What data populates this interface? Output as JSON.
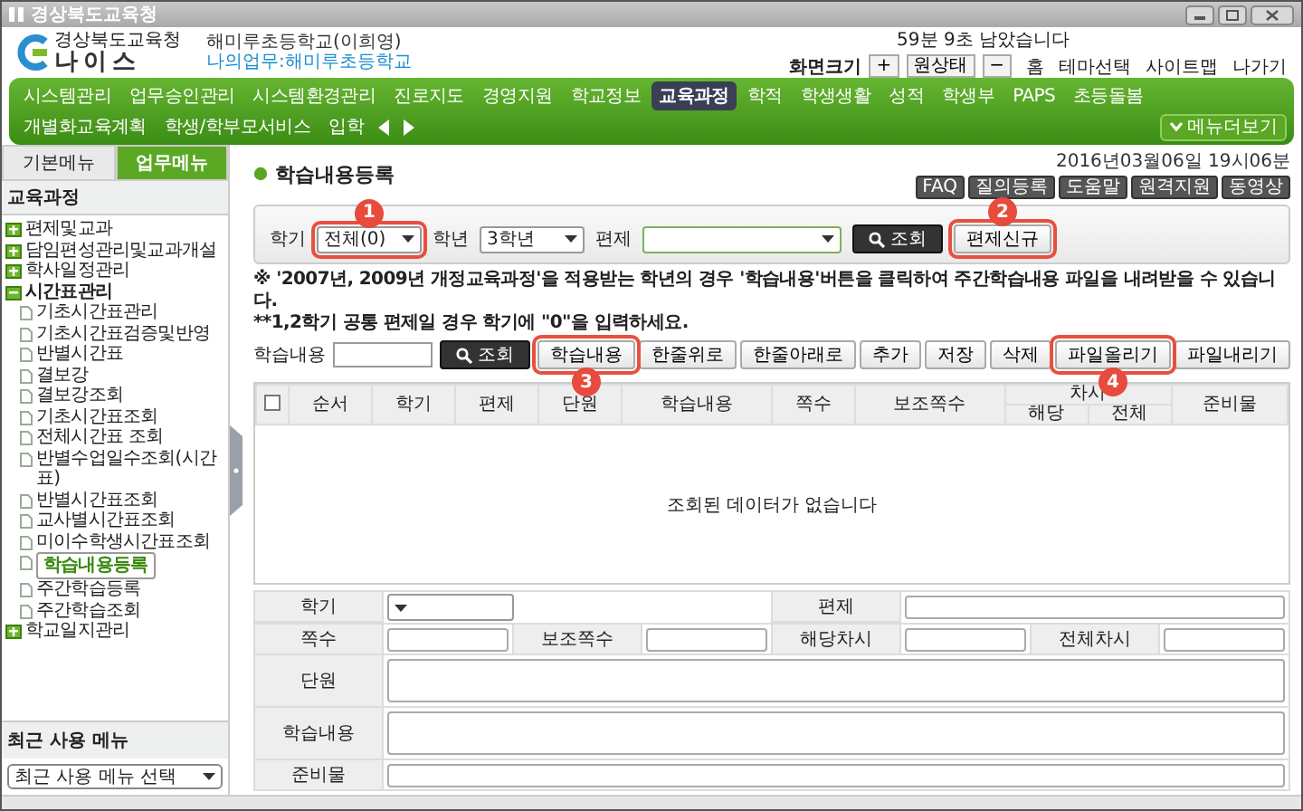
{
  "window": {
    "title": "경상북도교육청"
  },
  "header": {
    "logo_caption": "경상북도교육청",
    "logo_name": "나이스",
    "school": "해미루초등학교(이희영)",
    "my_work": "나의업무:해미루초등학교",
    "session": "59분 9초 남았습니다",
    "zoom_label": "화면크기",
    "zoom_buttons": [
      "+",
      "원상태",
      "−"
    ],
    "links": [
      "홈",
      "테마선택",
      "사이트맵",
      "나가기"
    ]
  },
  "menu": {
    "items": [
      {
        "label": "시스템관리",
        "selected": false
      },
      {
        "label": "업무승인관리",
        "selected": false
      },
      {
        "label": "시스템환경관리",
        "selected": false
      },
      {
        "label": "진로지도",
        "selected": false
      },
      {
        "label": "경영지원",
        "selected": false
      },
      {
        "label": "학교정보",
        "selected": false
      },
      {
        "label": "교육과정",
        "selected": true
      },
      {
        "label": "학적",
        "selected": false
      },
      {
        "label": "학생생활",
        "selected": false
      },
      {
        "label": "성적",
        "selected": false
      },
      {
        "label": "학생부",
        "selected": false
      },
      {
        "label": "PAPS",
        "selected": false
      },
      {
        "label": "초등돌봄",
        "selected": false
      },
      {
        "label": "개별화교육계획",
        "selected": false
      },
      {
        "label": "학생/학부모서비스",
        "selected": false
      },
      {
        "label": "입학",
        "selected": false
      }
    ],
    "more": "메뉴더보기"
  },
  "sidebar": {
    "tabs": [
      {
        "label": "기본메뉴",
        "selected": false
      },
      {
        "label": "업무메뉴",
        "selected": true
      }
    ],
    "heading": "교육과정",
    "tree": [
      {
        "label": "편제및교과",
        "expanded": false,
        "selected": false
      },
      {
        "label": "담임편성관리및교과개설",
        "expanded": false,
        "selected": false
      },
      {
        "label": "학사일정관리",
        "expanded": false,
        "selected": false
      },
      {
        "label": "시간표관리",
        "expanded": true,
        "selected": false,
        "children": [
          {
            "label": "기초시간표관리",
            "selected": false
          },
          {
            "label": "기초시간표검증및반영",
            "selected": false
          },
          {
            "label": "반별시간표",
            "selected": false
          },
          {
            "label": "결보강",
            "selected": false
          },
          {
            "label": "결보강조회",
            "selected": false
          },
          {
            "label": "기초시간표조회",
            "selected": false
          },
          {
            "label": "전체시간표 조회",
            "selected": false
          },
          {
            "label": "반별수업일수조회(시간표)",
            "selected": false
          },
          {
            "label": "반별시간표조회",
            "selected": false
          },
          {
            "label": "교사별시간표조회",
            "selected": false
          },
          {
            "label": "미이수학생시간표조회",
            "selected": false
          },
          {
            "label": "학습내용등록",
            "selected": true
          },
          {
            "label": "주간학습등록",
            "selected": false
          },
          {
            "label": "주간학습조회",
            "selected": false
          }
        ]
      },
      {
        "label": "학교일지관리",
        "expanded": false,
        "selected": false
      }
    ],
    "recent": {
      "heading": "최근 사용 메뉴",
      "select": "최근 사용 메뉴 선택"
    }
  },
  "page": {
    "title": "학습내용등록",
    "timestamp": "2016년03월06일 19시06분",
    "tools": [
      "FAQ",
      "질의등록",
      "도움말",
      "원격지원",
      "동영상"
    ]
  },
  "filter": {
    "fields": [
      {
        "kind": "select",
        "label": "학기",
        "value": "전체(0)",
        "callout": "1"
      },
      {
        "kind": "select",
        "label": "학년",
        "value": "3학년"
      },
      {
        "kind": "wide-select",
        "label": "편제"
      }
    ],
    "buttons": [
      {
        "kind": "search",
        "label": "조회"
      },
      {
        "kind": "plain",
        "label": "편제신규",
        "callout": "2"
      }
    ]
  },
  "notes": [
    "※ '2007년, 2009년 개정교육과정'을 적용받는 학년의 경우 '학습내용'버튼을 클릭하여 주간학습내용 파일을 내려받을 수 있습니다.",
    "**1,2학기 공통 편제일 경우 학기에 \"0\"을 입력하세요."
  ],
  "search": {
    "label": "학습내용",
    "button": "조회"
  },
  "actions": [
    {
      "label": "학습내용",
      "callout": "3"
    },
    {
      "label": "한줄위로"
    },
    {
      "label": "한줄아래로"
    },
    {
      "label": "추가"
    },
    {
      "label": "저장"
    },
    {
      "label": "삭제"
    },
    {
      "label": "파일올리기",
      "callout": "4"
    },
    {
      "label": "파일내리기"
    }
  ],
  "table": {
    "select_all": {
      "checked": false
    },
    "columns": [
      {
        "label": "순서"
      },
      {
        "label": "학기"
      },
      {
        "label": "편제"
      },
      {
        "label": "단원"
      },
      {
        "label": "학습내용"
      },
      {
        "label": "쪽수"
      },
      {
        "label": "보조쪽수"
      },
      {
        "label": "차시",
        "sub": [
          "해당",
          "전체"
        ]
      },
      {
        "label": "준비물"
      }
    ],
    "empty_message": "조회된 데이터가 없습니다"
  },
  "form": {
    "fields": [
      {
        "label": "학기",
        "kind": "select"
      },
      {
        "label": "편제",
        "kind": "half-text"
      },
      {
        "label": "쪽수",
        "kind": "text"
      },
      {
        "label": "보조쪽수",
        "kind": "text"
      },
      {
        "label": "해당차시",
        "kind": "text"
      },
      {
        "label": "전체차시",
        "kind": "text"
      },
      {
        "label": "단원",
        "kind": "area"
      },
      {
        "label": "학습내용",
        "kind": "area"
      },
      {
        "label": "준비물",
        "kind": "line"
      }
    ]
  }
}
